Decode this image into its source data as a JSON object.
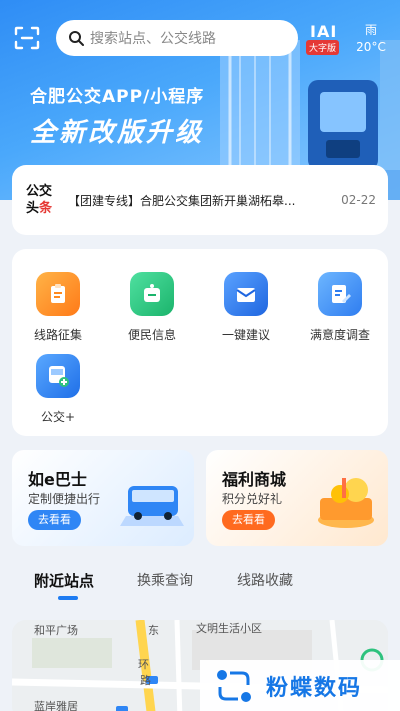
{
  "header": {
    "search_placeholder": "搜索站点、公交线路",
    "big_font_glyph": "IAI",
    "big_font_label": "大字版",
    "weather": {
      "condition": "雨",
      "temperature": "20°C"
    }
  },
  "banner": {
    "line1": "合肥公交APP/小程序",
    "line2": "全新改版升级"
  },
  "news": {
    "logo_top": "公交",
    "logo_bottom_left": "头",
    "logo_bottom_right": "条",
    "headline": "【团建专线】合肥公交集团新开巢湖柘皋...",
    "date": "02-22"
  },
  "services": [
    {
      "label": "线路征集",
      "icon": "clipboard-icon",
      "color": "#ff8a1f"
    },
    {
      "label": "便民信息",
      "icon": "info-card-icon",
      "color": "#22c07a"
    },
    {
      "label": "一键建议",
      "icon": "envelope-icon",
      "color": "#2e7cf6"
    },
    {
      "label": "满意度调查",
      "icon": "survey-edit-icon",
      "color": "#3b8ef8"
    },
    {
      "label": "公交+",
      "icon": "bus-plus-icon",
      "color": "#2f86f5"
    }
  ],
  "promos": [
    {
      "title": "如e巴士",
      "subtitle": "定制便捷出行",
      "button": "去看看",
      "accent": "#2f86f5"
    },
    {
      "title": "福利商城",
      "subtitle": "积分兑好礼",
      "button": "去看看",
      "accent": "#ff6a1f"
    }
  ],
  "tabs": [
    "附近站点",
    "换乘查询",
    "线路收藏"
  ],
  "map": {
    "labels": [
      "和平广场",
      "东",
      "文明生活小区",
      "环",
      "路",
      "蓝岸雅居"
    ]
  },
  "watermark": {
    "text": "粉蝶数码"
  }
}
